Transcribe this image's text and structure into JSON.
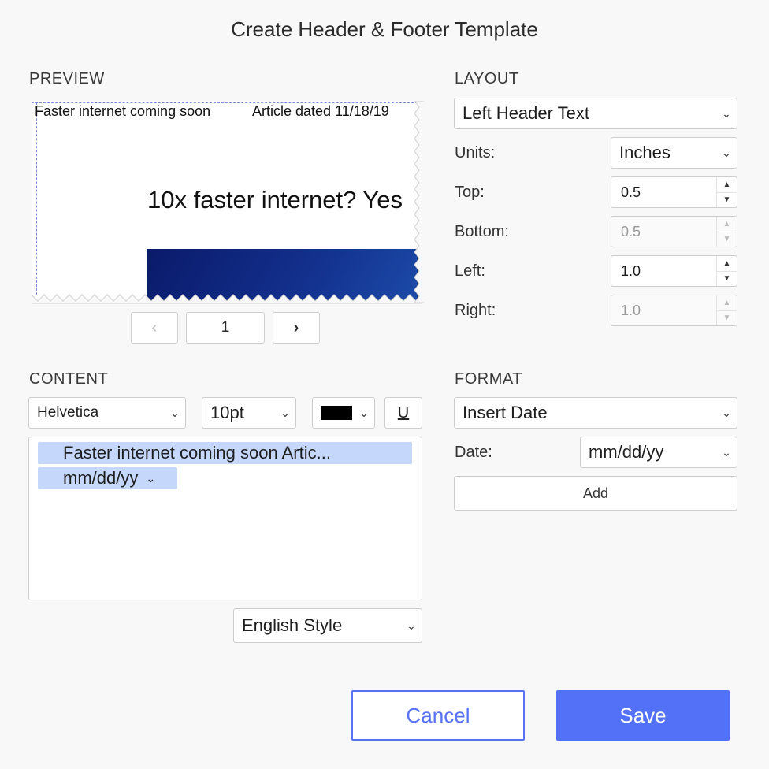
{
  "dialog": {
    "title": "Create Header & Footer Template"
  },
  "preview": {
    "label": "PREVIEW",
    "header_text": "Faster internet coming soon",
    "header_date": "Article dated 11/18/19",
    "headline": "10x faster internet? Yes",
    "pager": {
      "prev": "‹",
      "page": "1",
      "next": "›"
    }
  },
  "layout": {
    "label": "LAYOUT",
    "position": "Left Header Text",
    "units_label": "Units:",
    "units_value": "Inches",
    "top_label": "Top:",
    "top_value": "0.5",
    "bottom_label": "Bottom:",
    "bottom_value": "0.5",
    "left_label": "Left:",
    "left_value": "1.0",
    "right_label": "Right:",
    "right_value": "1.0"
  },
  "content": {
    "label": "CONTENT",
    "font": "Helvetica",
    "size": "10pt",
    "color": "#000000",
    "underline_label": "U",
    "token_text": "Faster internet coming soon     Artic...",
    "token_date": "mm/dd/yy",
    "style": "English Style"
  },
  "format": {
    "label": "FORMAT",
    "insert": "Insert Date",
    "date_label": "Date:",
    "date_value": "mm/dd/yy",
    "add_label": "Add"
  },
  "actions": {
    "cancel": "Cancel",
    "save": "Save"
  }
}
